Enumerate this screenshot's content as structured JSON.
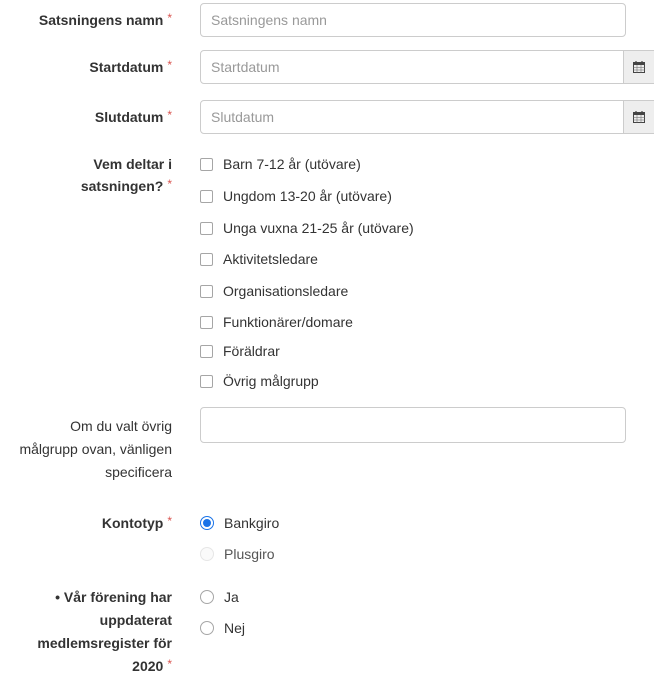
{
  "form": {
    "name": {
      "label": "Satsningens namn",
      "required_mark": "*",
      "placeholder": "Satsningens namn"
    },
    "start_date": {
      "label": "Startdatum",
      "required_mark": "*",
      "placeholder": "Startdatum",
      "icon": "calendar-icon"
    },
    "end_date": {
      "label": "Slutdatum",
      "required_mark": "*",
      "placeholder": "Slutdatum",
      "icon": "calendar-icon"
    },
    "participants": {
      "label_line1": "Vem deltar i",
      "label_line2": "satsningen?",
      "required_mark": "*",
      "options": [
        {
          "label": "Barn 7-12 år (utövare)",
          "checked": false
        },
        {
          "label": "Ungdom 13-20 år (utövare)",
          "checked": false
        },
        {
          "label": "Unga vuxna 21-25 år (utövare)",
          "checked": false
        },
        {
          "label": "Aktivitetsledare",
          "checked": false
        },
        {
          "label": "Organisationsledare",
          "checked": false
        },
        {
          "label": "Funktionärer/domare",
          "checked": false
        },
        {
          "label": "Föräldrar",
          "checked": false
        },
        {
          "label": "Övrig målgrupp",
          "checked": false
        }
      ]
    },
    "other_group": {
      "label_line1": "Om du valt övrig",
      "label_line2": "målgrupp ovan, vänligen",
      "label_line3": "specificera",
      "value": ""
    },
    "account_type": {
      "label": "Kontotyp",
      "required_mark": "*",
      "options": [
        {
          "label": "Bankgiro",
          "selected": true
        },
        {
          "label": "Plusgiro",
          "selected": false
        }
      ]
    },
    "member_register": {
      "label_line1": "• Vår förening har",
      "label_line2": "uppdaterat",
      "label_line3": "medlemsregister för",
      "label_line4": "2020",
      "required_mark": "*",
      "options": [
        {
          "label": "Ja",
          "selected": false
        },
        {
          "label": "Nej",
          "selected": false
        }
      ]
    }
  },
  "colors": {
    "required": "#d9534f",
    "accent": "#1a73e8",
    "border": "#cccccc",
    "addon_bg": "#eeeeee"
  }
}
